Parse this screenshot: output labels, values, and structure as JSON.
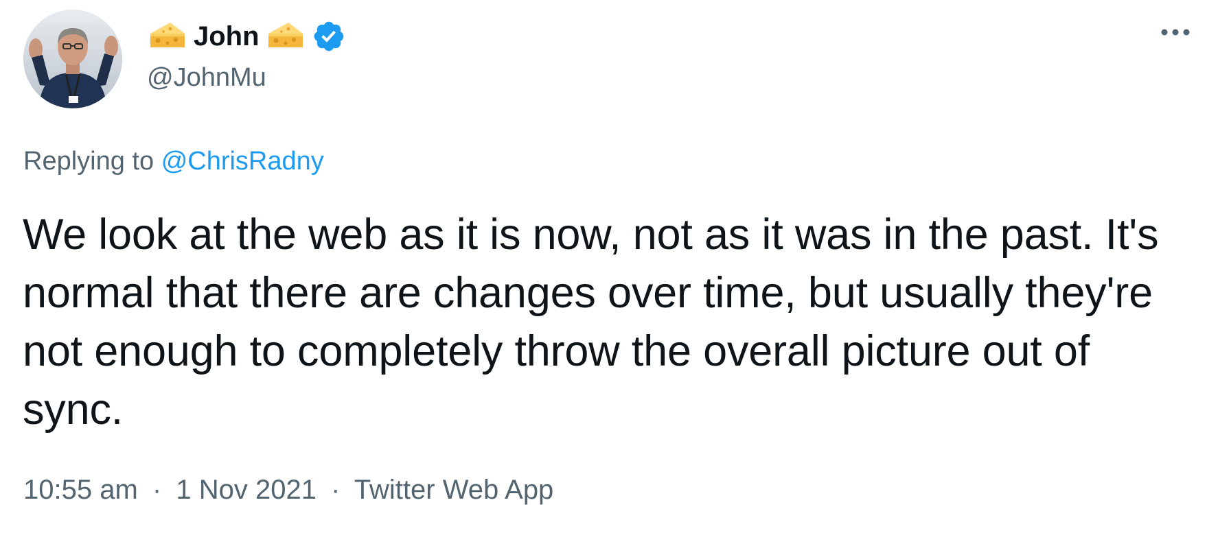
{
  "author": {
    "display_name": "John",
    "handle": "@JohnMu",
    "name_emoji": "cheese-icon",
    "verified_icon": "verified-badge-icon",
    "verified_color": "#1d9bf0"
  },
  "reply": {
    "prefix": "Replying to",
    "to_handle": "@ChrisRadny"
  },
  "tweet": {
    "text": "We look at the web as it is now, not as it was in the past. It's normal that there are changes over time, but usually they're not enough to completely throw the overall picture out of sync."
  },
  "meta": {
    "time": "10:55 am",
    "separator": "·",
    "date": "1 Nov 2021",
    "source": "Twitter Web App"
  },
  "colors": {
    "text_primary": "#0f1419",
    "text_secondary": "#536471",
    "link": "#1d9bf0"
  },
  "icons": {
    "more": "more-horizontal-icon"
  }
}
